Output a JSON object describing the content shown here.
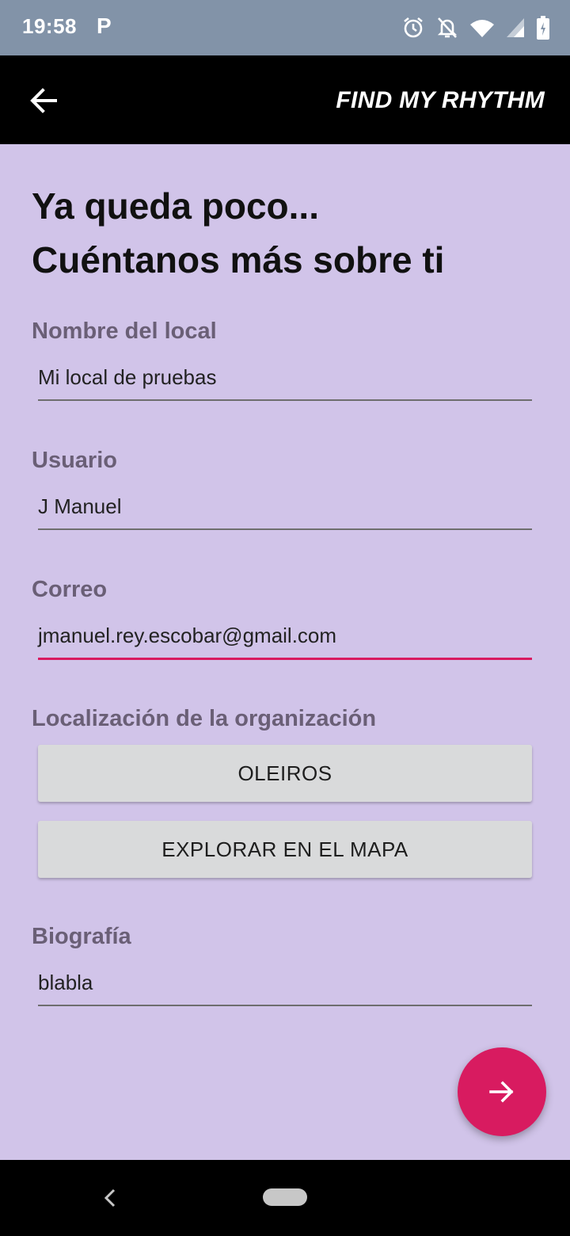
{
  "status_bar": {
    "time": "19:58",
    "notification_icon": "P",
    "icons": [
      "alarm-icon",
      "bell-off-icon",
      "wifi-icon",
      "signal-icon",
      "battery-icon"
    ]
  },
  "app_bar": {
    "title": "FIND MY RHYTHM",
    "back_icon": "arrow-left-icon"
  },
  "heading": {
    "line1": "Ya queda poco...",
    "line2": "Cuéntanos más sobre ti"
  },
  "form": {
    "local_name": {
      "label": "Nombre del local",
      "value": "Mi local de pruebas"
    },
    "user": {
      "label": "Usuario",
      "value": "J Manuel"
    },
    "email": {
      "label": "Correo",
      "value": "jmanuel.rey.escobar@gmail.com"
    },
    "location": {
      "label": "Localización de la organización",
      "selected_button": "OLEIROS",
      "map_button": "EXPLORAR EN EL MAPA"
    },
    "bio": {
      "label": "Biografía",
      "value": "blabla"
    }
  },
  "fab": {
    "icon": "arrow-right-icon"
  },
  "colors": {
    "background": "#d1c4e9",
    "accent": "#d81b60",
    "label": "#6a5f76",
    "app_bar": "#000000"
  }
}
